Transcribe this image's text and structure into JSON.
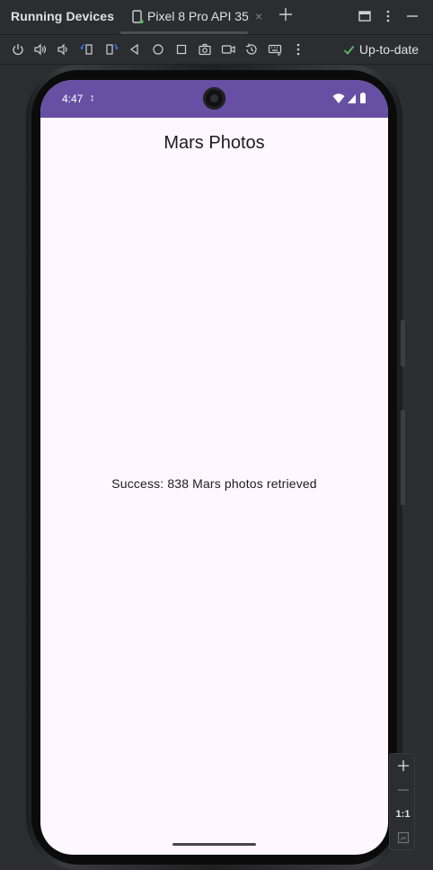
{
  "ide": {
    "panel_title": "Running Devices",
    "tab_label": "Pixel 8 Pro API 35",
    "tab_close": "×",
    "status_text": "Up-to-date"
  },
  "toolbar": {
    "icons": [
      "power-icon",
      "volume-up-icon",
      "volume-down-icon",
      "rotate-left-icon",
      "rotate-right-icon",
      "back-icon",
      "home-icon",
      "overview-icon",
      "screenshot-icon",
      "screen-record-icon",
      "reset-icon",
      "keyboard-icon",
      "more-icon"
    ]
  },
  "phone": {
    "status_time": "4:47",
    "status_extra": "↕",
    "app_title": "Mars Photos",
    "message": "Success: 838 Mars photos retrieved"
  },
  "zoom": {
    "one_to_one": "1:1"
  },
  "colors": {
    "status_bar": "#6750a4",
    "screen_bg": "#fef7ff",
    "ide_bg": "#2b2d30",
    "check": "#5fb865"
  }
}
